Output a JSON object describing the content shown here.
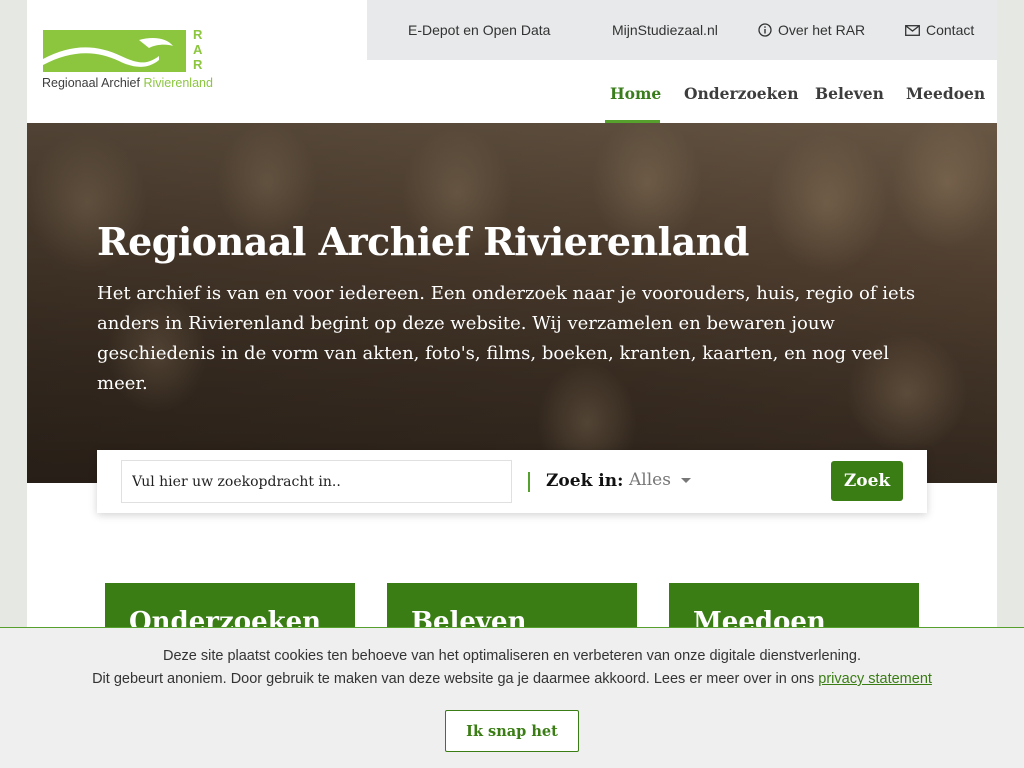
{
  "logo": {
    "letters": "RAR",
    "name_part1": "Regionaal Archief ",
    "name_part2": "Rivierenland"
  },
  "topbar": {
    "links": [
      {
        "label": "E-Depot en Open Data"
      },
      {
        "label": "MijnStudiezaal.nl"
      },
      {
        "label": "Over het RAR",
        "icon": "info-icon"
      },
      {
        "label": "Contact",
        "icon": "envelope-icon"
      }
    ]
  },
  "nav": {
    "items": [
      {
        "label": "Home",
        "active": true
      },
      {
        "label": "Onderzoeken"
      },
      {
        "label": "Beleven"
      },
      {
        "label": "Meedoen"
      }
    ]
  },
  "hero": {
    "title": "Regionaal Archief Rivierenland",
    "text": "Het archief is van en voor iedereen. Een onderzoek naar je voorouders, huis, regio of iets anders in Rivierenland begint op deze website. Wij verzamelen en bewaren jouw geschiedenis in de vorm van akten, foto's, films, boeken, kranten, kaarten, en nog veel meer."
  },
  "search": {
    "placeholder": "Vul hier uw zoekopdracht in..",
    "value": "",
    "zoek_in_label": "Zoek in:",
    "selected": "Alles",
    "button": "Zoek"
  },
  "cards": [
    {
      "title": "Onderzoeken"
    },
    {
      "title": "Beleven"
    },
    {
      "title": "Meedoen"
    }
  ],
  "cookie": {
    "line1": "Deze site plaatst cookies ten behoeve van het optimaliseren en verbeteren van onze digitale dienstverlening.",
    "line2": "Dit gebeurt anoniem. Door gebruik te maken van deze website ga je daarmee akkoord. Lees er meer over in ons ",
    "link": "privacy statement",
    "button": "Ik snap het"
  },
  "colors": {
    "brand_green": "#3a7d14",
    "logo_green": "#8cc63f",
    "topbar_bg": "#e7e9ea"
  }
}
